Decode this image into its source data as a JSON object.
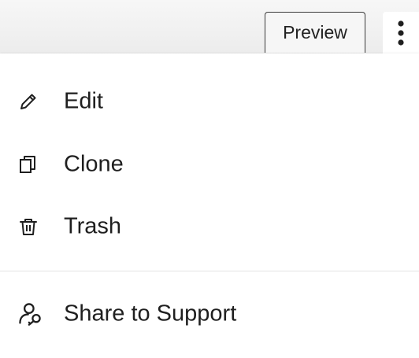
{
  "toolbar": {
    "preview_label": "Preview",
    "more_icon": "more-vertical-icon"
  },
  "menu": {
    "items": [
      {
        "label": "Edit",
        "icon": "pencil-icon"
      },
      {
        "label": "Clone",
        "icon": "copy-icon"
      },
      {
        "label": "Trash",
        "icon": "trash-icon"
      }
    ],
    "support_item": {
      "label": "Share to Support",
      "icon": "user-key-icon"
    }
  }
}
